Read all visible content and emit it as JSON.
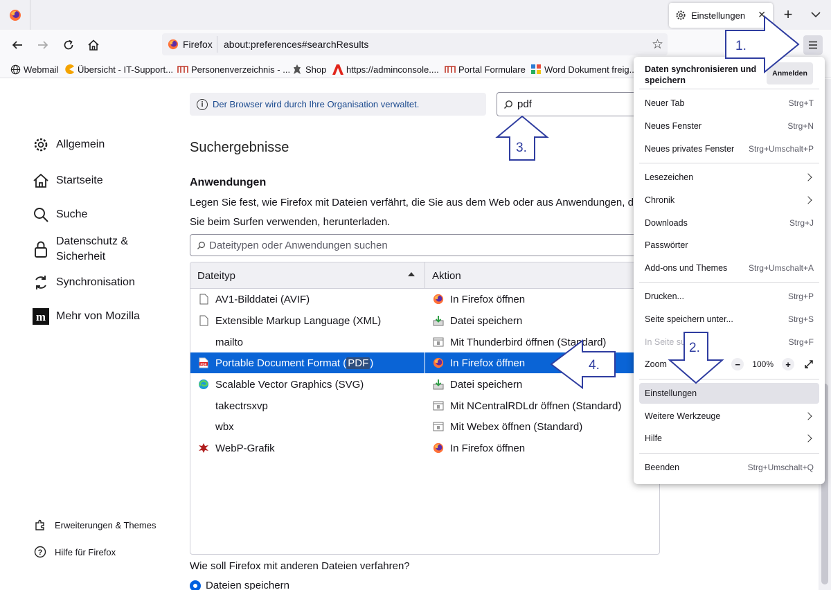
{
  "tab": {
    "title": "Einstellungen",
    "close": "✕"
  },
  "newtab": "+",
  "urlbar": {
    "identity": "Firefox",
    "url": "about:preferences#searchResults"
  },
  "bookmarks": [
    {
      "label": "Webmail",
      "icon": "globe-icon"
    },
    {
      "label": "Übersicht - IT-Support...",
      "icon": "pacman-icon"
    },
    {
      "label": "Personenverzeichnis - ...",
      "icon": "logo-icon"
    },
    {
      "label": "Shop",
      "icon": "shop-icon"
    },
    {
      "label": "https://adminconsole....",
      "icon": "adobe-icon"
    },
    {
      "label": "Portal Formulare",
      "icon": "logo-icon"
    },
    {
      "label": "Word Dokument freig...",
      "icon": "word-icon"
    }
  ],
  "policy_notice": "Der Browser wird durch Ihre Organisation verwaltet.",
  "search": {
    "query": "pdf"
  },
  "sidebar": {
    "items": [
      {
        "label": "Allgemein",
        "icon": "gear-icon"
      },
      {
        "label": "Startseite",
        "icon": "home-icon"
      },
      {
        "label": "Suche",
        "icon": "search-icon"
      },
      {
        "label": "Datenschutz &",
        "label2": "Sicherheit",
        "icon": "lock-icon"
      },
      {
        "label": "Synchronisation",
        "icon": "sync-icon"
      },
      {
        "label": "Mehr von Mozilla",
        "icon": "mozilla-icon"
      }
    ],
    "bottom": [
      {
        "label": "Erweiterungen & Themes",
        "icon": "puzzle-icon"
      },
      {
        "label": "Hilfe für Firefox",
        "icon": "help-icon"
      }
    ]
  },
  "main": {
    "title": "Suchergebnisse",
    "section": "Anwendungen",
    "desc_line1": "Legen Sie fest, wie Firefox mit Dateien verfährt, die Sie aus dem Web oder aus Anwendungen, d",
    "desc_line2": "Sie beim Surfen verwenden, herunterladen.",
    "filter_placeholder": "Dateitypen oder Anwendungen suchen",
    "columns": {
      "type": "Dateityp",
      "action": "Aktion"
    },
    "rows": [
      {
        "type": "AV1-Bilddatei (AVIF)",
        "type_icon": "file-icon",
        "action": "In Firefox öffnen",
        "action_icon": "firefox-icon"
      },
      {
        "type": "Extensible Markup Language (XML)",
        "type_icon": "file-icon",
        "action": "Datei speichern",
        "action_icon": "save-icon"
      },
      {
        "type": "mailto",
        "type_icon": "none",
        "action": "Mit Thunderbird öffnen (Standard)",
        "action_icon": "app-icon"
      },
      {
        "type_pre": "Portable Document Format (",
        "type_hl": "PDF",
        "type_post": ")",
        "type_icon": "pdf-icon",
        "action": "In Firefox öffnen",
        "action_icon": "firefox-icon",
        "selected": true
      },
      {
        "type": "Scalable Vector Graphics (SVG)",
        "type_icon": "edge-icon",
        "action": "Datei speichern",
        "action_icon": "save-icon"
      },
      {
        "type": "takectrsxvp",
        "type_icon": "none",
        "action": "Mit NCentralRDLdr öffnen (Standard)",
        "action_icon": "app-icon"
      },
      {
        "type": "wbx",
        "type_icon": "none",
        "action": "Mit Webex öffnen (Standard)",
        "action_icon": "app-icon"
      },
      {
        "type": "WebP-Grafik",
        "type_icon": "webp-icon",
        "action": "In Firefox öffnen",
        "action_icon": "firefox-icon"
      }
    ],
    "other_files_question": "Wie soll Firefox mit anderen Dateien verfahren?",
    "radio_label": "Dateien speichern"
  },
  "appmenu": {
    "sync_title": "Daten synchronisieren und speichern",
    "signin": "Anmelden",
    "items": [
      {
        "label": "Neuer Tab",
        "shortcut": "Strg+T"
      },
      {
        "label": "Neues Fenster",
        "shortcut": "Strg+N"
      },
      {
        "label": "Neues privates Fenster",
        "shortcut": "Strg+Umschalt+P"
      },
      {
        "label": "Lesezeichen",
        "shortcut": ""
      },
      {
        "label": "Chronik",
        "shortcut": ""
      },
      {
        "label": "Downloads",
        "shortcut": "Strg+J"
      },
      {
        "label": "Passwörter",
        "shortcut": ""
      },
      {
        "label": "Add-ons und Themes",
        "shortcut": "Strg+Umschalt+A"
      },
      {
        "label": "Drucken...",
        "shortcut": "Strg+P"
      },
      {
        "label": "Seite speichern unter...",
        "shortcut": "Strg+S"
      },
      {
        "label": "In Seite su",
        "shortcut": "Strg+F"
      },
      {
        "label": "Zoom",
        "shortcut": ""
      },
      {
        "label": "Einstellungen",
        "shortcut": ""
      },
      {
        "label": "Weitere Werkzeuge",
        "shortcut": ""
      },
      {
        "label": "Hilfe",
        "shortcut": ""
      },
      {
        "label": "Beenden",
        "shortcut": "Strg+Umschalt+Q"
      }
    ],
    "zoom": {
      "minus": "−",
      "value": "100%",
      "plus": "+"
    }
  },
  "annotations": {
    "a1": "1.",
    "a2": "2.",
    "a3": "3.",
    "a4": "4."
  },
  "colors": {
    "selection": "#0a64d6",
    "arrow": "#2f3da0",
    "accent": "#0060df"
  }
}
